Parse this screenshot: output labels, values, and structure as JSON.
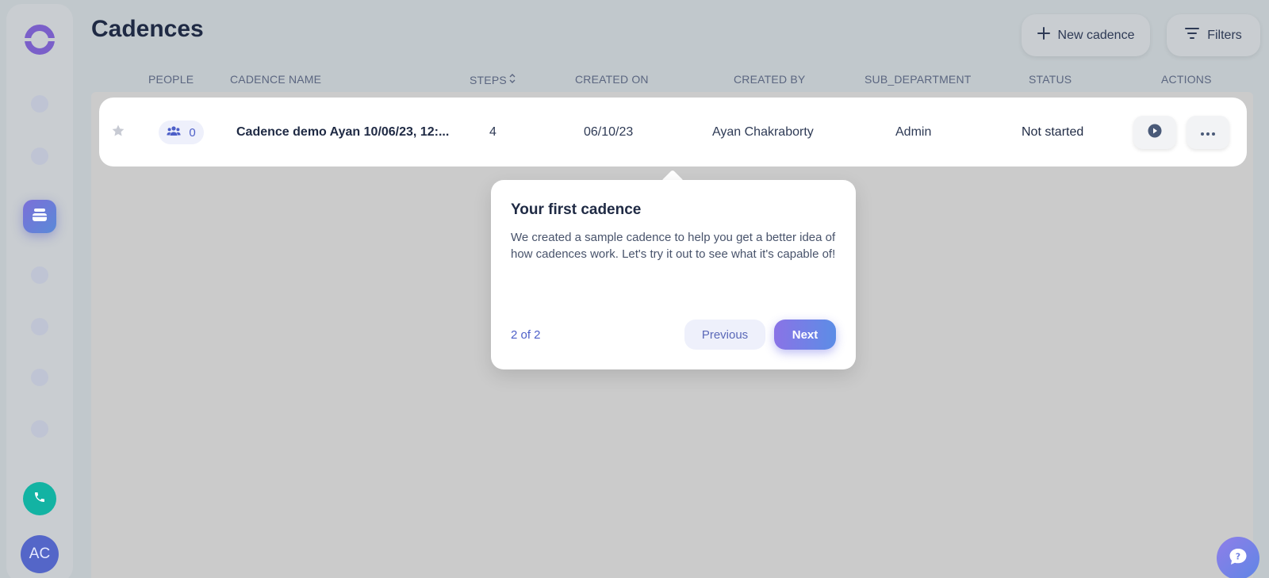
{
  "page": {
    "title": "Cadences"
  },
  "header": {
    "new_cadence_label": "New cadence",
    "filters_label": "Filters"
  },
  "table": {
    "columns": [
      "PEOPLE",
      "CADENCE NAME",
      "STEPS",
      "CREATED ON",
      "CREATED BY",
      "SUB_DEPARTMENT",
      "STATUS",
      "ACTIONS"
    ],
    "rows": [
      {
        "people_count": "0",
        "name": "Cadence demo Ayan 10/06/23, 12:...",
        "steps": "4",
        "created_on": "06/10/23",
        "created_by": "Ayan Chakraborty",
        "sub_department": "Admin",
        "status": "Not started"
      }
    ]
  },
  "sidebar": {
    "avatar_initials": "AC"
  },
  "popover": {
    "title": "Your first cadence",
    "body": "We created a sample cadence to help you get a better idea of how cadences work. Let's try it out to see what it's capable of!",
    "step": "2 of 2",
    "previous_label": "Previous",
    "next_label": "Next"
  },
  "colors": {
    "accent": "#5c6fd6",
    "call": "#13b3a3",
    "avatar": "#5466c8"
  },
  "icons": [
    "logo-icon",
    "inbox-icon",
    "phone-icon",
    "plus-icon",
    "filter-icon",
    "star-icon",
    "people-icon",
    "sort-icon",
    "play-icon",
    "more-icon",
    "chat-help-icon"
  ]
}
